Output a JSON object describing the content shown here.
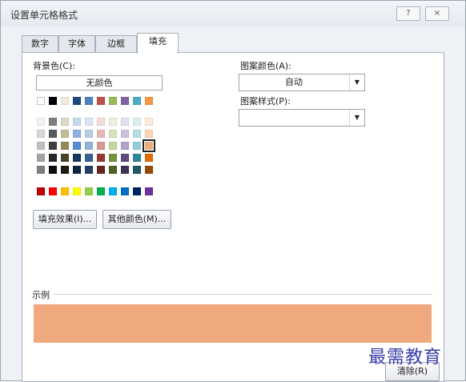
{
  "title": "设置单元格格式",
  "titlebar_buttons": [
    "?",
    "×"
  ],
  "tabs": [
    {
      "label": "数字",
      "active": false
    },
    {
      "label": "字体",
      "active": false
    },
    {
      "label": "边框",
      "active": false
    },
    {
      "label": "填充",
      "active": true
    }
  ],
  "background_color": {
    "label": "背景色(C):",
    "no_color_label": "无颜色",
    "selected_color": "#f0a97e"
  },
  "swatches": {
    "standard_row": [
      "#ffffff",
      "#000000",
      "#eeece1",
      "#1f497d",
      "#4f81bd",
      "#c0504d",
      "#9bbb59",
      "#8064a2",
      "#4bacc6",
      "#f79646"
    ],
    "theme_grid": [
      [
        "#f2f2f2",
        "#7f7f7f",
        "#ddd9c3",
        "#c6d9f0",
        "#dbe5f1",
        "#f2dcdb",
        "#ebf1dd",
        "#e5e0ec",
        "#dbeef3",
        "#fdeada"
      ],
      [
        "#d8d8d8",
        "#595959",
        "#c4bd97",
        "#8db3e2",
        "#b8cce4",
        "#e5b9b7",
        "#d7e3bc",
        "#ccc1d9",
        "#b7dde8",
        "#fbd5b5"
      ],
      [
        "#bfbfbf",
        "#3f3f3f",
        "#938953",
        "#548dd4",
        "#95b3d7",
        "#d99694",
        "#c3d69b",
        "#b2a2c7",
        "#92cddc",
        "#fac08f"
      ],
      [
        "#a5a5a5",
        "#262626",
        "#494429",
        "#17365d",
        "#366092",
        "#953734",
        "#76923c",
        "#5f497a",
        "#31859b",
        "#e36c09"
      ],
      [
        "#7f7f7f",
        "#0c0c0c",
        "#1d1b10",
        "#0f243e",
        "#244061",
        "#632423",
        "#4f6128",
        "#3f3151",
        "#205867",
        "#974806"
      ]
    ],
    "standard_colors": [
      "#c00000",
      "#ff0000",
      "#ffc000",
      "#ffff00",
      "#92d050",
      "#00b050",
      "#00b0f0",
      "#0070c0",
      "#002060",
      "#7030a0"
    ]
  },
  "buttons": {
    "fill_effects": "填充效果(I)...",
    "more_colors": "其他颜色(M)...",
    "clear": "清除(R)"
  },
  "pattern_color": {
    "label": "图案颜色(A):",
    "value": "自动"
  },
  "pattern_style": {
    "label": "图案样式(P):",
    "value": ""
  },
  "sample": {
    "label": "示例",
    "color": "#f0a97e"
  },
  "watermark": "最需教育"
}
